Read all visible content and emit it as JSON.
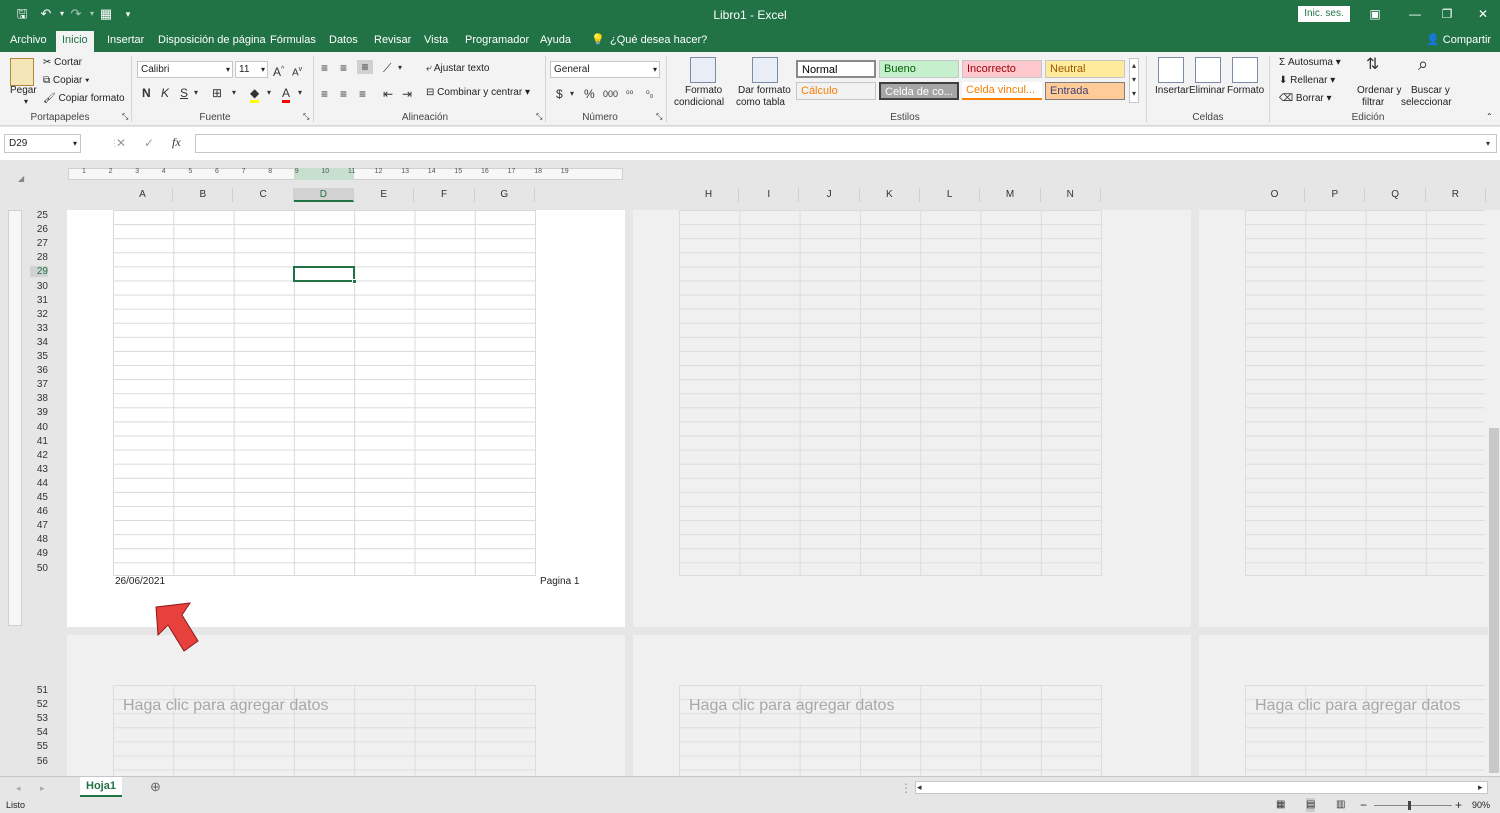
{
  "window": {
    "title": "Libro1 - Excel",
    "sign_in": "Inic. ses."
  },
  "tabs": [
    "Archivo",
    "Inicio",
    "Insertar",
    "Disposición de página",
    "Fórmulas",
    "Datos",
    "Revisar",
    "Vista",
    "Programador",
    "Ayuda"
  ],
  "tell_me": "¿Qué desea hacer?",
  "share": "Compartir",
  "ribbon": {
    "clipboard": {
      "paste": "Pegar",
      "cut": "Cortar",
      "copy": "Copiar",
      "format_painter": "Copiar formato",
      "label": "Portapapeles"
    },
    "font": {
      "name": "Calibri",
      "size": "11",
      "bold": "N",
      "italic": "K",
      "underline": "S",
      "label": "Fuente"
    },
    "alignment": {
      "wrap": "Ajustar texto",
      "merge": "Combinar y centrar",
      "label": "Alineación"
    },
    "number": {
      "format": "General",
      "label": "Número"
    },
    "styles": {
      "cond_format_1": "Formato",
      "cond_format_2": "condicional",
      "table_format_1": "Dar formato",
      "table_format_2": "como tabla",
      "cells": [
        {
          "text": "Normal",
          "bg": "#ffffff",
          "fg": "#000000"
        },
        {
          "text": "Bueno",
          "bg": "#c6efce",
          "fg": "#006100"
        },
        {
          "text": "Incorrecto",
          "bg": "#ffc7ce",
          "fg": "#9c0006"
        },
        {
          "text": "Neutral",
          "bg": "#ffeb9c",
          "fg": "#9c5700"
        },
        {
          "text": "Cálculo",
          "bg": "#f2f2f2",
          "fg": "#fa7d00"
        },
        {
          "text": "Celda de co...",
          "bg": "#a5a5a5",
          "fg": "#ffffff"
        },
        {
          "text": "Celda vincul...",
          "bg": "#ffffff",
          "fg": "#fa7d00"
        },
        {
          "text": "Entrada",
          "bg": "#ffcc99",
          "fg": "#3f3f76"
        }
      ],
      "label": "Estilos"
    },
    "cells": {
      "insert": "Insertar",
      "delete": "Eliminar",
      "format": "Formato",
      "label": "Celdas"
    },
    "editing": {
      "autosum": "Autosuma",
      "fill": "Rellenar",
      "clear": "Borrar",
      "sort_1": "Ordenar y",
      "sort_2": "filtrar",
      "find_1": "Buscar y",
      "find_2": "seleccionar",
      "label": "Edición"
    }
  },
  "formula_bar": {
    "name_box": "D29",
    "fx": "fx",
    "value": ""
  },
  "ruler": [
    "1",
    "2",
    "3",
    "4",
    "5",
    "6",
    "7",
    "8",
    "9",
    "10",
    "11",
    "12",
    "13",
    "14",
    "15",
    "16",
    "17",
    "18",
    "19"
  ],
  "columns": {
    "page1": [
      "A",
      "B",
      "C",
      "D",
      "E",
      "F",
      "G"
    ],
    "page2": [
      "H",
      "I",
      "J",
      "K",
      "L",
      "M",
      "N"
    ],
    "page3": [
      "O",
      "P",
      "Q",
      "R"
    ]
  },
  "rows_top": [
    "25",
    "26",
    "27",
    "28",
    "29",
    "30",
    "31",
    "32",
    "33",
    "34",
    "35",
    "36",
    "37",
    "38",
    "39",
    "40",
    "41",
    "42",
    "43",
    "44",
    "45",
    "46",
    "47",
    "48",
    "49",
    "50"
  ],
  "rows_bottom": [
    "51",
    "52",
    "53",
    "54",
    "55",
    "56"
  ],
  "footer": {
    "date": "26/06/2021",
    "page": "Pagina 1"
  },
  "placeholder": "Haga clic para agregar datos",
  "sheet_tab": "Hoja1",
  "status": {
    "mode": "Listo",
    "zoom": "90%"
  },
  "colors": {
    "accent": "#217346",
    "arrow": "#e8413d"
  }
}
